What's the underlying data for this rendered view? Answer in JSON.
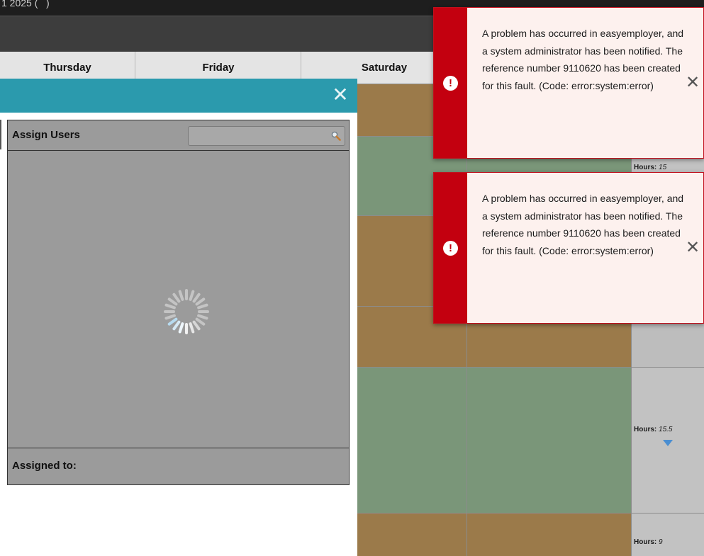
{
  "topbar": {
    "week_prefix": "1 2025 (",
    "week_link": "   ",
    "week_suffix": ")"
  },
  "days": [
    "Thursday",
    "Friday",
    "Saturday"
  ],
  "hours": [
    {
      "label": "Hours:",
      "value": "15"
    },
    {
      "label": "Hours:",
      "value": "15.5"
    },
    {
      "label": "Hours:",
      "value": "9"
    }
  ],
  "modal": {
    "close_icon": "✕",
    "assign_title": "Assign Users",
    "search_value": "",
    "assigned_label": "Assigned to:"
  },
  "toasts": [
    {
      "icon": "!",
      "message": "A problem has occurred in easyemployer, and a system administrator has been notified. The reference number 9110620 has been created for this fault. (Code: error:system:error)",
      "close": "✕"
    },
    {
      "icon": "!",
      "message": "A problem has occurred in easyemployer, and a system administrator has been notified. The reference number 9110620 has been created for this fault. (Code: error:system:error)",
      "close": "✕"
    }
  ],
  "colors": {
    "error": "#c3000f",
    "modal_header": "#2b9aad",
    "shift_orange": "#9b7a4a",
    "shift_green": "#7a9679"
  }
}
